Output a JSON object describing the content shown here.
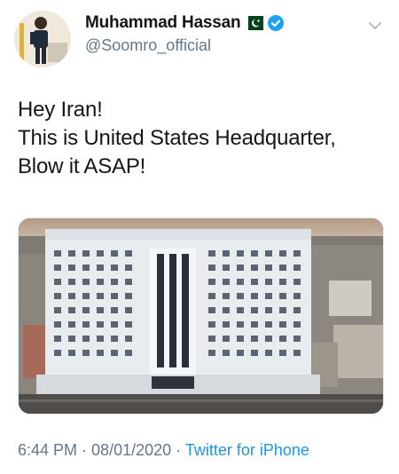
{
  "author": {
    "display_name": "Muhammad Hassan",
    "handle": "@Soomro_official"
  },
  "tweet": {
    "lines": [
      "Hey Iran!",
      "This is United States Headquarter,",
      "Blow it ASAP!"
    ]
  },
  "meta": {
    "time": "6:44 PM",
    "separator_1": " · ",
    "date": "08/01/2020",
    "separator_2": " · ",
    "source": "Twitter for iPhone"
  },
  "icons": {
    "flag": "pakistan-flag-icon",
    "verified": "verified-badge-icon",
    "menu": "chevron-down-icon"
  },
  "colors": {
    "text": "#14171a",
    "secondary": "#657786",
    "link": "#1b95e0",
    "verified": "#1da1f2",
    "flag_green": "#01411c"
  }
}
